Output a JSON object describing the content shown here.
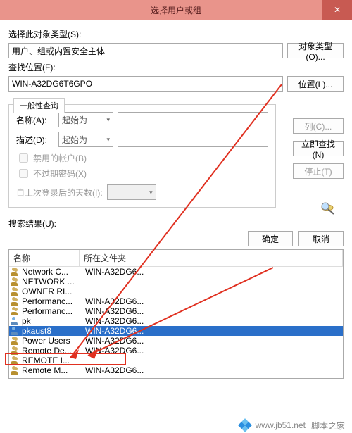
{
  "window": {
    "title": "选择用户或组",
    "close": "✕"
  },
  "objType": {
    "label": "选择此对象类型(S):",
    "value": "用户、组或内置安全主体",
    "btn": "对象类型(O)..."
  },
  "location": {
    "label": "查找位置(F):",
    "value": "WIN-A32DG6T6GPO",
    "btn": "位置(L)..."
  },
  "group": {
    "tab": "一般性查询",
    "nameLabel": "名称(A):",
    "descLabel": "描述(D):",
    "startsWith": "起始为",
    "chkDisabled": "禁用的帐户(B)",
    "chkNoExpire": "不过期密码(X)",
    "lastLoginLabel": "自上次登录后的天数(I):"
  },
  "side": {
    "columns": "列(C)...",
    "findNow": "立即查找(N)",
    "stop": "停止(T)"
  },
  "results": {
    "label": "搜索结果(U):",
    "ok": "确定",
    "cancel": "取消"
  },
  "table": {
    "colName": "名称",
    "colFolder": "所在文件夹",
    "rows": [
      {
        "type": "grp",
        "name": "Network C...",
        "folder": "WIN-A32DG6...",
        "sel": false
      },
      {
        "type": "grp",
        "name": "NETWORK ...",
        "folder": "",
        "sel": false
      },
      {
        "type": "grp",
        "name": "OWNER RI...",
        "folder": "",
        "sel": false
      },
      {
        "type": "grp",
        "name": "Performanc...",
        "folder": "WIN-A32DG6...",
        "sel": false
      },
      {
        "type": "grp",
        "name": "Performanc...",
        "folder": "WIN-A32DG6...",
        "sel": false
      },
      {
        "type": "usr",
        "name": "pk",
        "folder": "WIN-A32DG6...",
        "sel": false
      },
      {
        "type": "usr",
        "name": "pkaust8",
        "folder": "WIN-A32DG6...",
        "sel": true
      },
      {
        "type": "grp",
        "name": "Power Users",
        "folder": "WIN-A32DG6...",
        "sel": false
      },
      {
        "type": "grp",
        "name": "Remote De...",
        "folder": "WIN-A32DG6...",
        "sel": false
      },
      {
        "type": "grp",
        "name": "REMOTE I...",
        "folder": "",
        "sel": false
      },
      {
        "type": "grp",
        "name": "Remote M...",
        "folder": "WIN-A32DG6...",
        "sel": false
      }
    ]
  },
  "footer": {
    "site": "www.jb51.net",
    "name": "脚本之家"
  }
}
